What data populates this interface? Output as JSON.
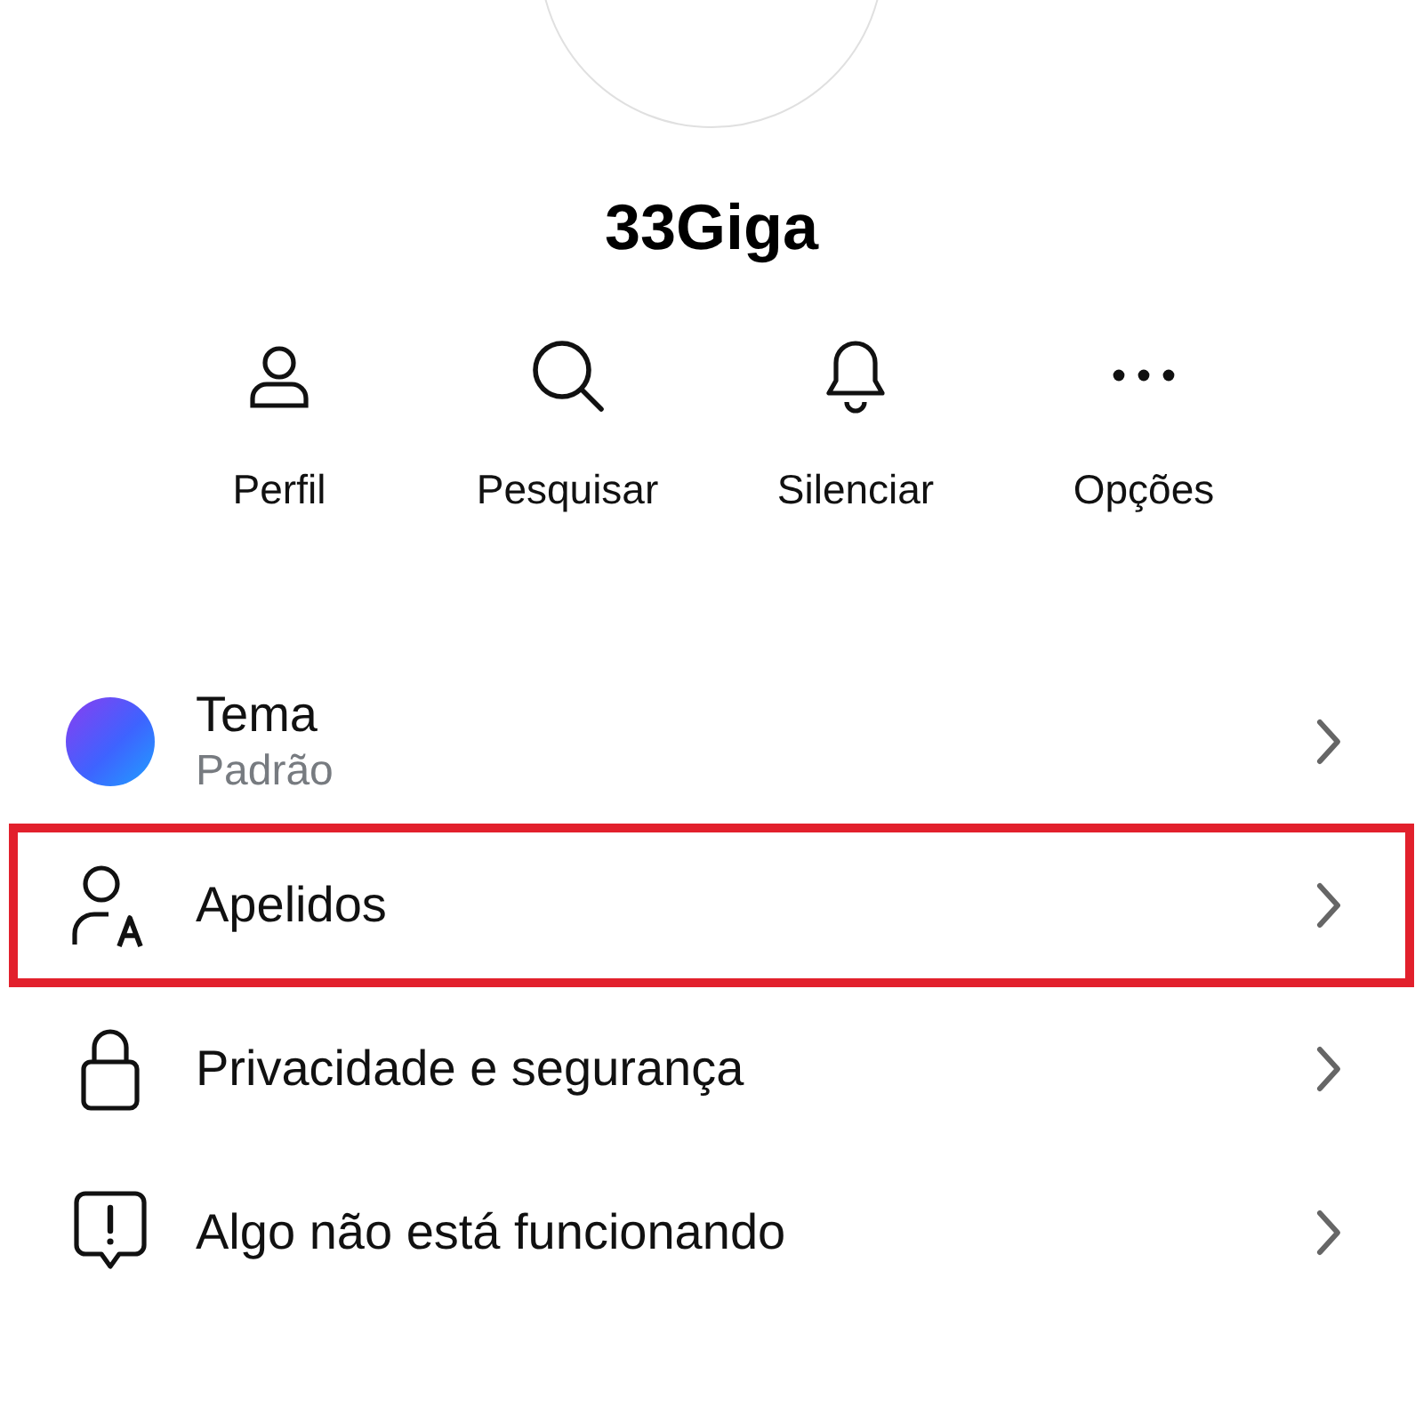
{
  "profile": {
    "name": "33Giga"
  },
  "actions": [
    {
      "kind": "person",
      "label": "Perfil"
    },
    {
      "kind": "search",
      "label": "Pesquisar"
    },
    {
      "kind": "bell",
      "label": "Silenciar"
    },
    {
      "kind": "more",
      "label": "Opções"
    }
  ],
  "settings": [
    {
      "kind": "theme",
      "title": "Tema",
      "subtitle": "Padrão",
      "highlighted": false
    },
    {
      "kind": "nickname",
      "title": "Apelidos",
      "highlighted": true
    },
    {
      "kind": "lock",
      "title": "Privacidade e segurança",
      "highlighted": false
    },
    {
      "kind": "alert",
      "title": "Algo não está funcionando",
      "highlighted": false
    }
  ]
}
